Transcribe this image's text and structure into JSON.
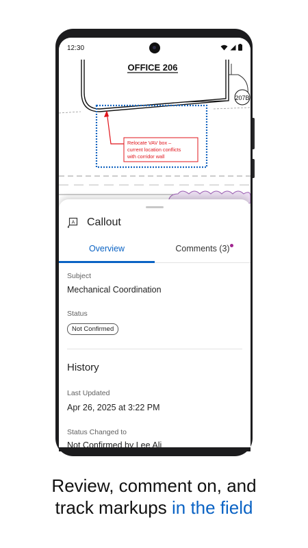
{
  "status_bar": {
    "time": "12:30"
  },
  "drawing": {
    "room_title": "OFFICE  206",
    "room_tag": "207B",
    "markup_text": [
      "Relocate VAV box –",
      "current location conflicts",
      "with corridor wall"
    ]
  },
  "panel": {
    "title": "Callout",
    "icon": "callout-icon",
    "tabs": {
      "overview": "Overview",
      "comments": "Comments (3)"
    },
    "subject_label": "Subject",
    "subject_value": "Mechanical Coordination",
    "status_label": "Status",
    "status_value": "Not Confirmed",
    "history_title": "History",
    "last_updated_label": "Last Updated",
    "last_updated_value": "Apr 26, 2025 at 3:22 PM",
    "status_changed_label": "Status Changed to",
    "status_changed_value": "Not Confirmed by Lee Ali"
  },
  "caption": {
    "line1": "Review, comment on, and",
    "line2_plain": "track markups ",
    "line2_highlight": "in the field"
  },
  "colors": {
    "accent": "#0b63c4",
    "markup_red": "#e0141b",
    "markup_blue": "#1565c0",
    "revision_cloud": "#b07cc6"
  }
}
